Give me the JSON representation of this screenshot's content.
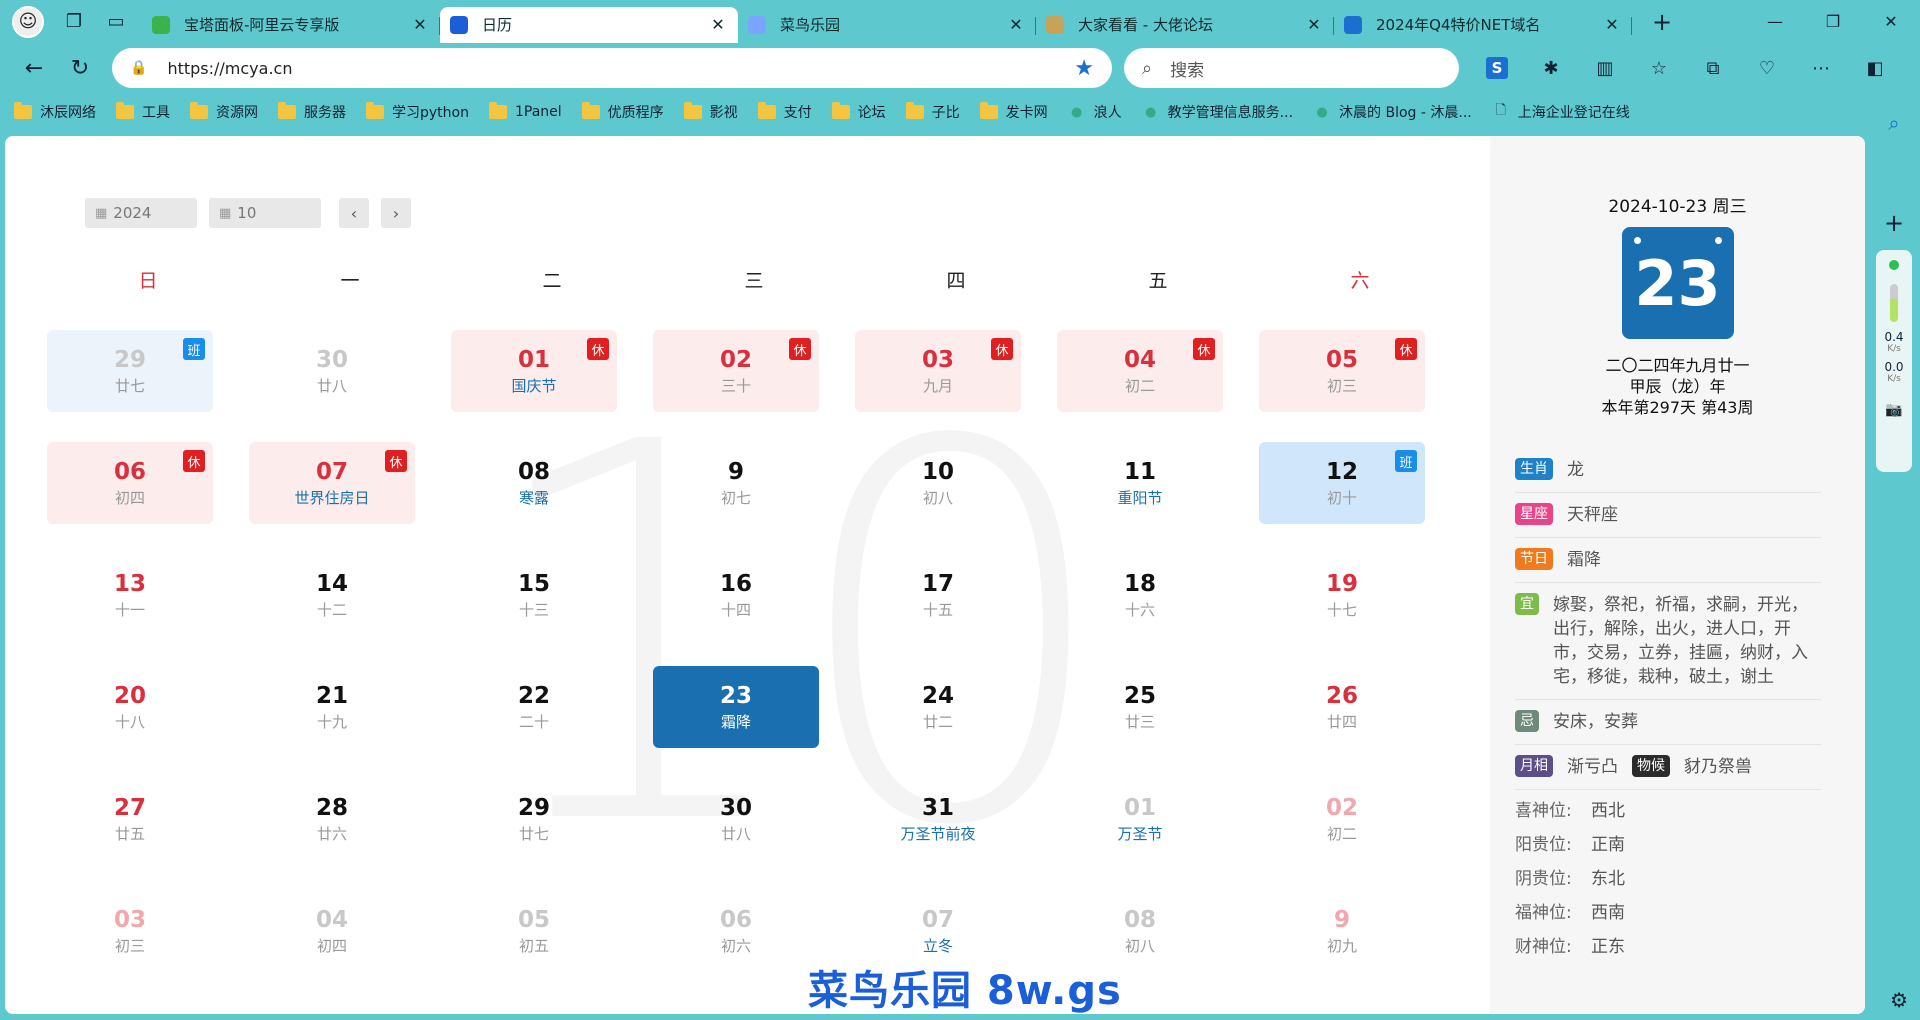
{
  "browser": {
    "tabs": [
      {
        "title": "宝塔面板-阿里云专享版",
        "favicon_color": "#3cb34a",
        "active": false
      },
      {
        "title": "日历",
        "favicon_color": "#1a5fd8",
        "active": true
      },
      {
        "title": "菜鸟乐园",
        "favicon_color": "#7aa5ff",
        "active": false
      },
      {
        "title": "大家看看 - 大佬论坛",
        "favicon_color": "#c9a25a",
        "active": false
      },
      {
        "title": "2024年Q4特价NET域名",
        "favicon_color": "#1a6fcf",
        "active": false
      }
    ],
    "url": "https://mcya.cn",
    "search_placeholder": "搜索",
    "bookmarks": [
      {
        "label": "沐辰网络",
        "type": "folder"
      },
      {
        "label": "工具",
        "type": "folder"
      },
      {
        "label": "资源网",
        "type": "folder"
      },
      {
        "label": "服务器",
        "type": "folder"
      },
      {
        "label": "学习python",
        "type": "folder"
      },
      {
        "label": "1Panel",
        "type": "folder"
      },
      {
        "label": "优质程序",
        "type": "folder"
      },
      {
        "label": "影视",
        "type": "folder"
      },
      {
        "label": "支付",
        "type": "folder"
      },
      {
        "label": "论坛",
        "type": "folder"
      },
      {
        "label": "子比",
        "type": "folder"
      },
      {
        "label": "发卡网",
        "type": "folder"
      },
      {
        "label": "浪人",
        "type": "site"
      },
      {
        "label": "教学管理信息服务...",
        "type": "site"
      },
      {
        "label": "沐晨的 Blog - 沐晨...",
        "type": "site"
      },
      {
        "label": "上海企业登记在线",
        "type": "page"
      }
    ],
    "meter": {
      "up": "0.4",
      "down": "0.0",
      "unit": "K/s"
    }
  },
  "calendar": {
    "year": "2024",
    "month": "10",
    "background_number": "10",
    "weekdays": [
      "日",
      "一",
      "二",
      "三",
      "四",
      "五",
      "六"
    ],
    "cells": [
      {
        "day": "29",
        "lunar": "廿七",
        "kind": "work dim",
        "badge": "班"
      },
      {
        "day": "30",
        "lunar": "廿八",
        "kind": "dim",
        "badge": ""
      },
      {
        "day": "01",
        "lunar": "国庆节",
        "kind": "hol",
        "badge": "休",
        "fest": true
      },
      {
        "day": "02",
        "lunar": "三十",
        "kind": "hol",
        "badge": "休"
      },
      {
        "day": "03",
        "lunar": "九月",
        "kind": "hol",
        "badge": "休"
      },
      {
        "day": "04",
        "lunar": "初二",
        "kind": "hol",
        "badge": "休"
      },
      {
        "day": "05",
        "lunar": "初三",
        "kind": "hol",
        "badge": "休"
      },
      {
        "day": "06",
        "lunar": "初四",
        "kind": "hol",
        "badge": "休"
      },
      {
        "day": "07",
        "lunar": "世界住房日",
        "kind": "hol",
        "badge": "休",
        "fest": true
      },
      {
        "day": "08",
        "lunar": "寒露",
        "kind": "",
        "badge": "",
        "fest": true
      },
      {
        "day": "9",
        "lunar": "初七",
        "kind": "",
        "badge": ""
      },
      {
        "day": "10",
        "lunar": "初八",
        "kind": "",
        "badge": ""
      },
      {
        "day": "11",
        "lunar": "重阳节",
        "kind": "",
        "badge": "",
        "fest": true
      },
      {
        "day": "12",
        "lunar": "初十",
        "kind": "work2",
        "badge": "班"
      },
      {
        "day": "13",
        "lunar": "十一",
        "kind": "wk",
        "badge": ""
      },
      {
        "day": "14",
        "lunar": "十二",
        "kind": "",
        "badge": ""
      },
      {
        "day": "15",
        "lunar": "十三",
        "kind": "",
        "badge": ""
      },
      {
        "day": "16",
        "lunar": "十四",
        "kind": "",
        "badge": ""
      },
      {
        "day": "17",
        "lunar": "十五",
        "kind": "",
        "badge": ""
      },
      {
        "day": "18",
        "lunar": "十六",
        "kind": "",
        "badge": ""
      },
      {
        "day": "19",
        "lunar": "十七",
        "kind": "wk",
        "badge": ""
      },
      {
        "day": "20",
        "lunar": "十八",
        "kind": "wk",
        "badge": ""
      },
      {
        "day": "21",
        "lunar": "十九",
        "kind": "",
        "badge": ""
      },
      {
        "day": "22",
        "lunar": "二十",
        "kind": "",
        "badge": ""
      },
      {
        "day": "23",
        "lunar": "霜降",
        "kind": "today",
        "badge": ""
      },
      {
        "day": "24",
        "lunar": "廿二",
        "kind": "",
        "badge": ""
      },
      {
        "day": "25",
        "lunar": "廿三",
        "kind": "",
        "badge": ""
      },
      {
        "day": "26",
        "lunar": "廿四",
        "kind": "wk",
        "badge": ""
      },
      {
        "day": "27",
        "lunar": "廿五",
        "kind": "wk",
        "badge": ""
      },
      {
        "day": "28",
        "lunar": "廿六",
        "kind": "",
        "badge": ""
      },
      {
        "day": "29",
        "lunar": "廿七",
        "kind": "",
        "badge": ""
      },
      {
        "day": "30",
        "lunar": "廿八",
        "kind": "",
        "badge": ""
      },
      {
        "day": "31",
        "lunar": "万圣节前夜",
        "kind": "",
        "badge": "",
        "fest": true
      },
      {
        "day": "01",
        "lunar": "万圣节",
        "kind": "dim",
        "badge": "",
        "fest": true
      },
      {
        "day": "02",
        "lunar": "初二",
        "kind": "dimred",
        "badge": ""
      },
      {
        "day": "03",
        "lunar": "初三",
        "kind": "dimred",
        "badge": ""
      },
      {
        "day": "04",
        "lunar": "初四",
        "kind": "dim",
        "badge": ""
      },
      {
        "day": "05",
        "lunar": "初五",
        "kind": "dim",
        "badge": ""
      },
      {
        "day": "06",
        "lunar": "初六",
        "kind": "dim",
        "badge": ""
      },
      {
        "day": "07",
        "lunar": "立冬",
        "kind": "dim",
        "badge": "",
        "fest": true
      },
      {
        "day": "08",
        "lunar": "初八",
        "kind": "dim",
        "badge": ""
      },
      {
        "day": "9",
        "lunar": "初九",
        "kind": "dimred",
        "badge": ""
      }
    ]
  },
  "detail": {
    "date_line": "2024-10-23 周三",
    "day": "23",
    "lunar_lines": [
      "二〇二四年九月廿一",
      "甲辰（龙）年",
      "本年第297天 第43周"
    ],
    "rows": [
      {
        "tag": "生肖",
        "color": "#1e82c8",
        "value": "龙"
      },
      {
        "tag": "星座",
        "color": "#e8448a",
        "value": "天秤座"
      },
      {
        "tag": "节日",
        "color": "#f07a1e",
        "value": "霜降"
      },
      {
        "tag": "宜",
        "color": "#7cbc4a",
        "value": "嫁娶，祭祀，祈福，求嗣，开光，出行，解除，出火，进人口，开市，交易，立券，挂匾，纳财，入宅，移徙，栽种，破土，谢土"
      },
      {
        "tag": "忌",
        "color": "#6f8a7a",
        "value": "安床，安葬"
      }
    ],
    "moon_tag": "月相",
    "moon_color": "#5b4e8a",
    "moon_value": "渐亏凸",
    "wuhou_tag": "物候",
    "wuhou_color": "#2b2b2b",
    "wuhou_value": "豺乃祭兽",
    "directions": [
      {
        "k": "喜神位:",
        "v": "西北"
      },
      {
        "k": "阳贵位:",
        "v": "正南"
      },
      {
        "k": "阴贵位:",
        "v": "东北"
      },
      {
        "k": "福神位:",
        "v": "西南"
      },
      {
        "k": "财神位:",
        "v": "正东"
      }
    ]
  },
  "watermark": "菜鸟乐园 8w.gs"
}
